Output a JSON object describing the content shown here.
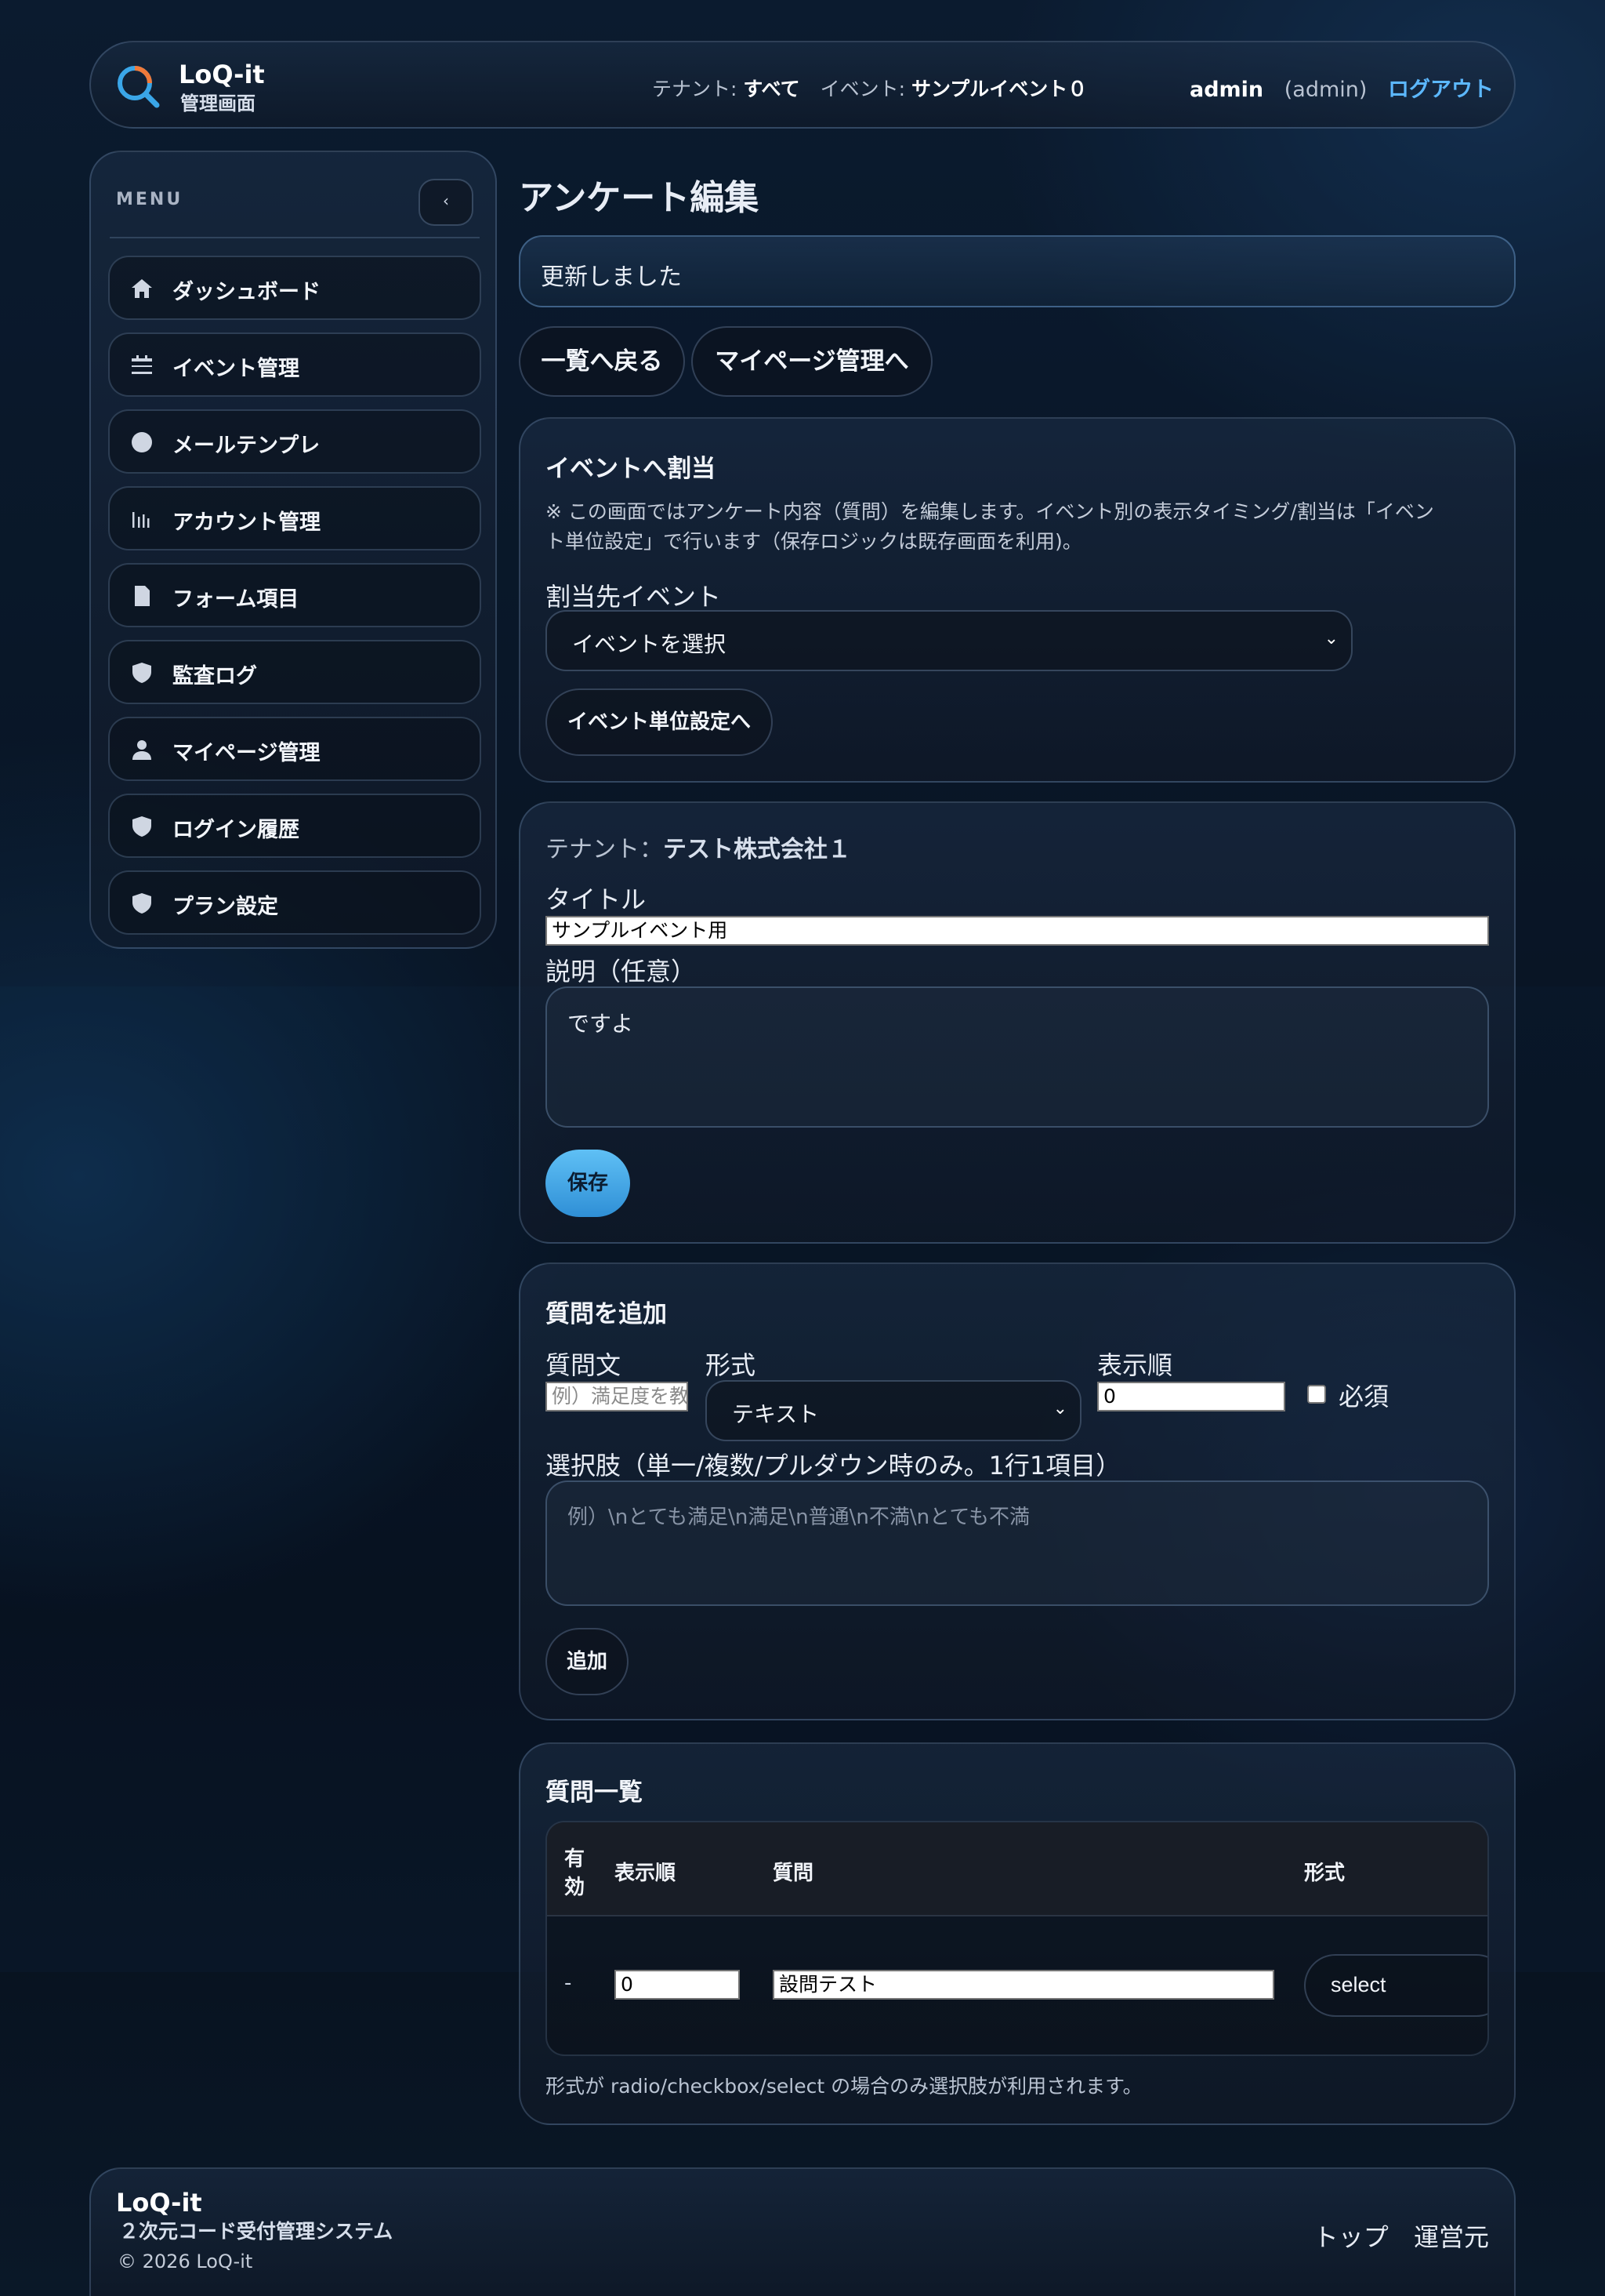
{
  "header": {
    "app_name": "LoQ-it",
    "app_sub": "管理画面",
    "tenant_label": "テナント:",
    "tenant_value": "すべて",
    "event_label": "イベント:",
    "event_value": "サンプルイベント０",
    "user_name": "admin",
    "user_role": "(admin)",
    "logout": "ログアウト"
  },
  "sidebar": {
    "menu_label": "MENU",
    "collapse_glyph": "‹",
    "items": [
      {
        "label": "ダッシュボード",
        "icon": "home-icon"
      },
      {
        "label": "イベント管理",
        "icon": "calendar-icon"
      },
      {
        "label": "メールテンプレ",
        "icon": "circle-icon"
      },
      {
        "label": "アカウント管理",
        "icon": "bar-chart-icon"
      },
      {
        "label": "フォーム項目",
        "icon": "document-icon"
      },
      {
        "label": "監査ログ",
        "icon": "shield-icon"
      },
      {
        "label": "マイページ管理",
        "icon": "user-icon"
      },
      {
        "label": "ログイン履歴",
        "icon": "shield-icon"
      },
      {
        "label": "プラン設定",
        "icon": "shield-icon"
      }
    ]
  },
  "page": {
    "title": "アンケート編集",
    "flash": "更新しました",
    "back_button": "一覧へ戻る",
    "mypage_button": "マイページ管理へ"
  },
  "assign_card": {
    "title": "イベントへ割当",
    "note_line1": "※ この画面ではアンケート内容（質問）を編集します。イベント別の表示タイミング/割当は「イベン",
    "note_line2": "ト単位設定」で行います（保存ロジックは既存画面を利用)。",
    "event_label": "割当先イベント",
    "event_select": "イベントを選択",
    "event_settings_button": "イベント単位設定へ"
  },
  "edit_card": {
    "tenant_label": "テナント：",
    "tenant_value": "テスト株式会社１",
    "title_label": "タイトル",
    "title_value": "サンプルイベント用",
    "desc_label": "説明（任意）",
    "desc_value": "ですよ",
    "save_button": "保存"
  },
  "add_card": {
    "title": "質問を追加",
    "question_label": "質問文",
    "question_placeholder": "例）満足度を教",
    "type_label": "形式",
    "type_value": "テキスト",
    "order_label": "表示順",
    "order_value": "0",
    "required_label": "必須",
    "required_checked": false,
    "options_label": "選択肢（単一/複数/プルダウン時のみ。1行1項目）",
    "options_placeholder": "例）\\nとても満足\\n満足\\n普通\\n不満\\nとても不満",
    "add_button": "追加"
  },
  "list_card": {
    "title": "質問一覧",
    "columns": {
      "enabled_1": "有",
      "enabled_2": "効",
      "order": "表示順",
      "question": "質問",
      "type": "形式"
    },
    "rows": [
      {
        "enabled": "-",
        "order": "0",
        "question": "設問テスト",
        "type": "select"
      }
    ],
    "footnote": "形式が radio/checkbox/select の場合のみ選択肢が利用されます。"
  },
  "footer": {
    "title": "LoQ-it",
    "subtitle": "２次元コード受付管理システム",
    "copyright": "© 2026 LoQ-it",
    "link_top": "トップ",
    "link_operator": "運営元"
  }
}
